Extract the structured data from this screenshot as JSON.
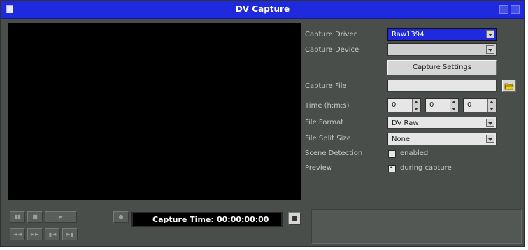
{
  "window": {
    "title": "DV Capture"
  },
  "form": {
    "capture_driver": {
      "label": "Capture Driver",
      "value": "Raw1394"
    },
    "capture_device": {
      "label": "Capture Device",
      "value": ""
    },
    "capture_settings_button": "Capture Settings",
    "capture_file": {
      "label": "Capture File",
      "value": ""
    },
    "time": {
      "label": "Time (h:m:s)",
      "h": "0",
      "m": "0",
      "s": "0"
    },
    "file_format": {
      "label": "File Format",
      "value": "DV Raw"
    },
    "file_split_size": {
      "label": "File Split Size",
      "value": "None"
    },
    "scene_detection": {
      "label": "Scene Detection",
      "option": "enabled",
      "checked": false
    },
    "preview": {
      "label": "Preview",
      "option": "during capture",
      "checked": true
    }
  },
  "transport": {
    "capture_time_label": "Capture Time:",
    "capture_time_value": "00:00:00:00"
  },
  "icons": {
    "transport_row1": [
      "pause-icon",
      "stop-icon",
      "play-icon"
    ],
    "transport_row2": [
      "rewind-icon",
      "fast-forward-icon",
      "prev-frame-icon",
      "next-frame-icon"
    ],
    "folder": "open-folder-icon"
  },
  "colors": {
    "titlebar": "#1f2adf",
    "window_bg": "#4a4e4a",
    "selected_field": "#1f2adf"
  }
}
